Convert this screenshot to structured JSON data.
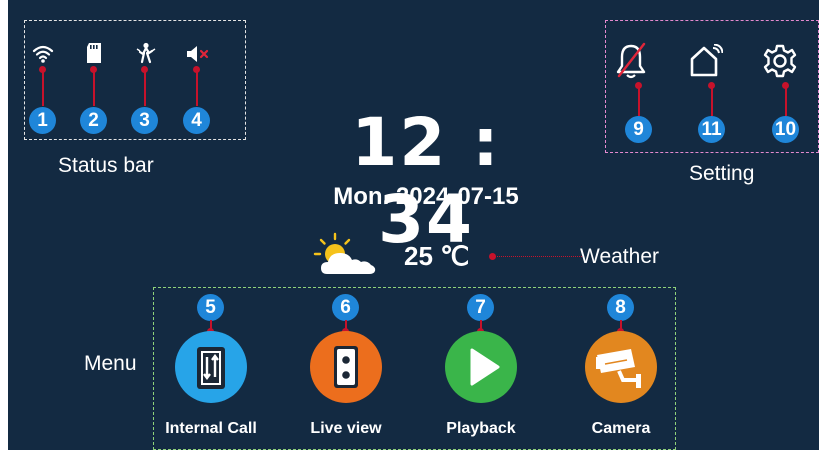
{
  "clock": {
    "time": "12 : 34",
    "date": "Mon.  2024-07-15"
  },
  "weather": {
    "temperature": "25 ℃",
    "label": "Weather",
    "icon": "partly-cloudy-icon"
  },
  "status_bar": {
    "label": "Status bar",
    "items": [
      {
        "badge": "1",
        "icon": "wifi-icon"
      },
      {
        "badge": "2",
        "icon": "sd-card-icon"
      },
      {
        "badge": "3",
        "icon": "motion-detection-icon"
      },
      {
        "badge": "4",
        "icon": "speaker-muted-icon"
      }
    ]
  },
  "setting": {
    "label": "Setting",
    "items": [
      {
        "badge": "9",
        "icon": "bell-off-icon"
      },
      {
        "badge": "11",
        "icon": "smart-home-icon"
      },
      {
        "badge": "10",
        "icon": "gear-icon"
      }
    ]
  },
  "menu": {
    "label": "Menu",
    "items": [
      {
        "badge": "5",
        "label": "Internal Call",
        "icon": "intercom-icon",
        "color": "#27a4e8"
      },
      {
        "badge": "6",
        "label": "Live view",
        "icon": "door-station-icon",
        "color": "#ec6e1d"
      },
      {
        "badge": "7",
        "label": "Playback",
        "icon": "play-icon",
        "color": "#3ab54a"
      },
      {
        "badge": "8",
        "label": "Camera",
        "icon": "cctv-camera-icon",
        "color": "#e2871f"
      }
    ]
  },
  "colors": {
    "background": "#132a42",
    "badge": "#1f86d9",
    "connector": "#c7122b",
    "status_border": "#e6e6e6",
    "setting_border": "#e58ad0",
    "menu_border": "#8fd27a"
  }
}
